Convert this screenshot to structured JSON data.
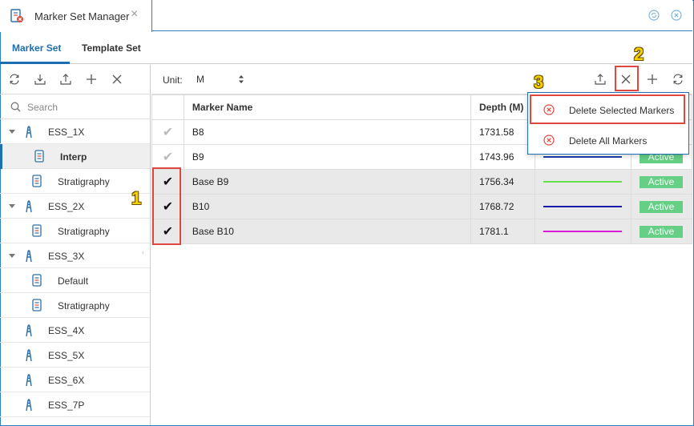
{
  "window": {
    "title": "Marker Set Manager",
    "close_glyph": "×"
  },
  "subtabs": [
    {
      "label": "Marker Set",
      "active": true
    },
    {
      "label": "Template Set",
      "active": false
    }
  ],
  "left_toolbar": {
    "icons": [
      "refresh-icon",
      "import-icon",
      "export-icon",
      "add-icon",
      "delete-icon"
    ]
  },
  "search": {
    "placeholder": "Search"
  },
  "tree": [
    {
      "label": "ESS_1X",
      "kind": "well",
      "expanded": true
    },
    {
      "label": "Interp",
      "kind": "set",
      "selected": true
    },
    {
      "label": "Stratigraphy",
      "kind": "set"
    },
    {
      "label": "ESS_2X",
      "kind": "well",
      "expanded": true
    },
    {
      "label": "Stratigraphy",
      "kind": "set"
    },
    {
      "label": "ESS_3X",
      "kind": "well",
      "expanded": true
    },
    {
      "label": "Default",
      "kind": "set"
    },
    {
      "label": "Stratigraphy",
      "kind": "set"
    },
    {
      "label": "ESS_4X",
      "kind": "well"
    },
    {
      "label": "ESS_5X",
      "kind": "well"
    },
    {
      "label": "ESS_6X",
      "kind": "well"
    },
    {
      "label": "ESS_7P",
      "kind": "well"
    }
  ],
  "main_toolbar": {
    "unit_label": "Unit:",
    "unit_value": "M",
    "icons": [
      "export-icon",
      "delete-icon",
      "add-icon",
      "refresh-icon"
    ]
  },
  "table": {
    "headers": {
      "name": "Marker Name",
      "depth": "Depth (M)"
    },
    "rows": [
      {
        "checked": false,
        "name": "B8",
        "depth": "1731.58",
        "color": "",
        "status": "Active"
      },
      {
        "checked": false,
        "name": "B9",
        "depth": "1743.96",
        "color": "#1a3db0",
        "status": "Active"
      },
      {
        "checked": true,
        "name": "Base B9",
        "depth": "1756.34",
        "color": "#66e04a",
        "status": "Active"
      },
      {
        "checked": true,
        "name": "B10",
        "depth": "1768.72",
        "color": "#1a1aa8",
        "status": "Active"
      },
      {
        "checked": true,
        "name": "Base B10",
        "depth": "1781.1",
        "color": "#d81ad8",
        "status": "Active"
      }
    ]
  },
  "delete_menu": {
    "items": [
      {
        "label": "Delete Selected Markers"
      },
      {
        "label": "Delete All Markers"
      }
    ]
  },
  "annotations": [
    "1",
    "2",
    "3"
  ],
  "colors": {
    "accent": "#1d6fb1",
    "highlight_red": "#e0473e",
    "callout_yellow": "#f4d000",
    "status_green": "#64cf85"
  }
}
